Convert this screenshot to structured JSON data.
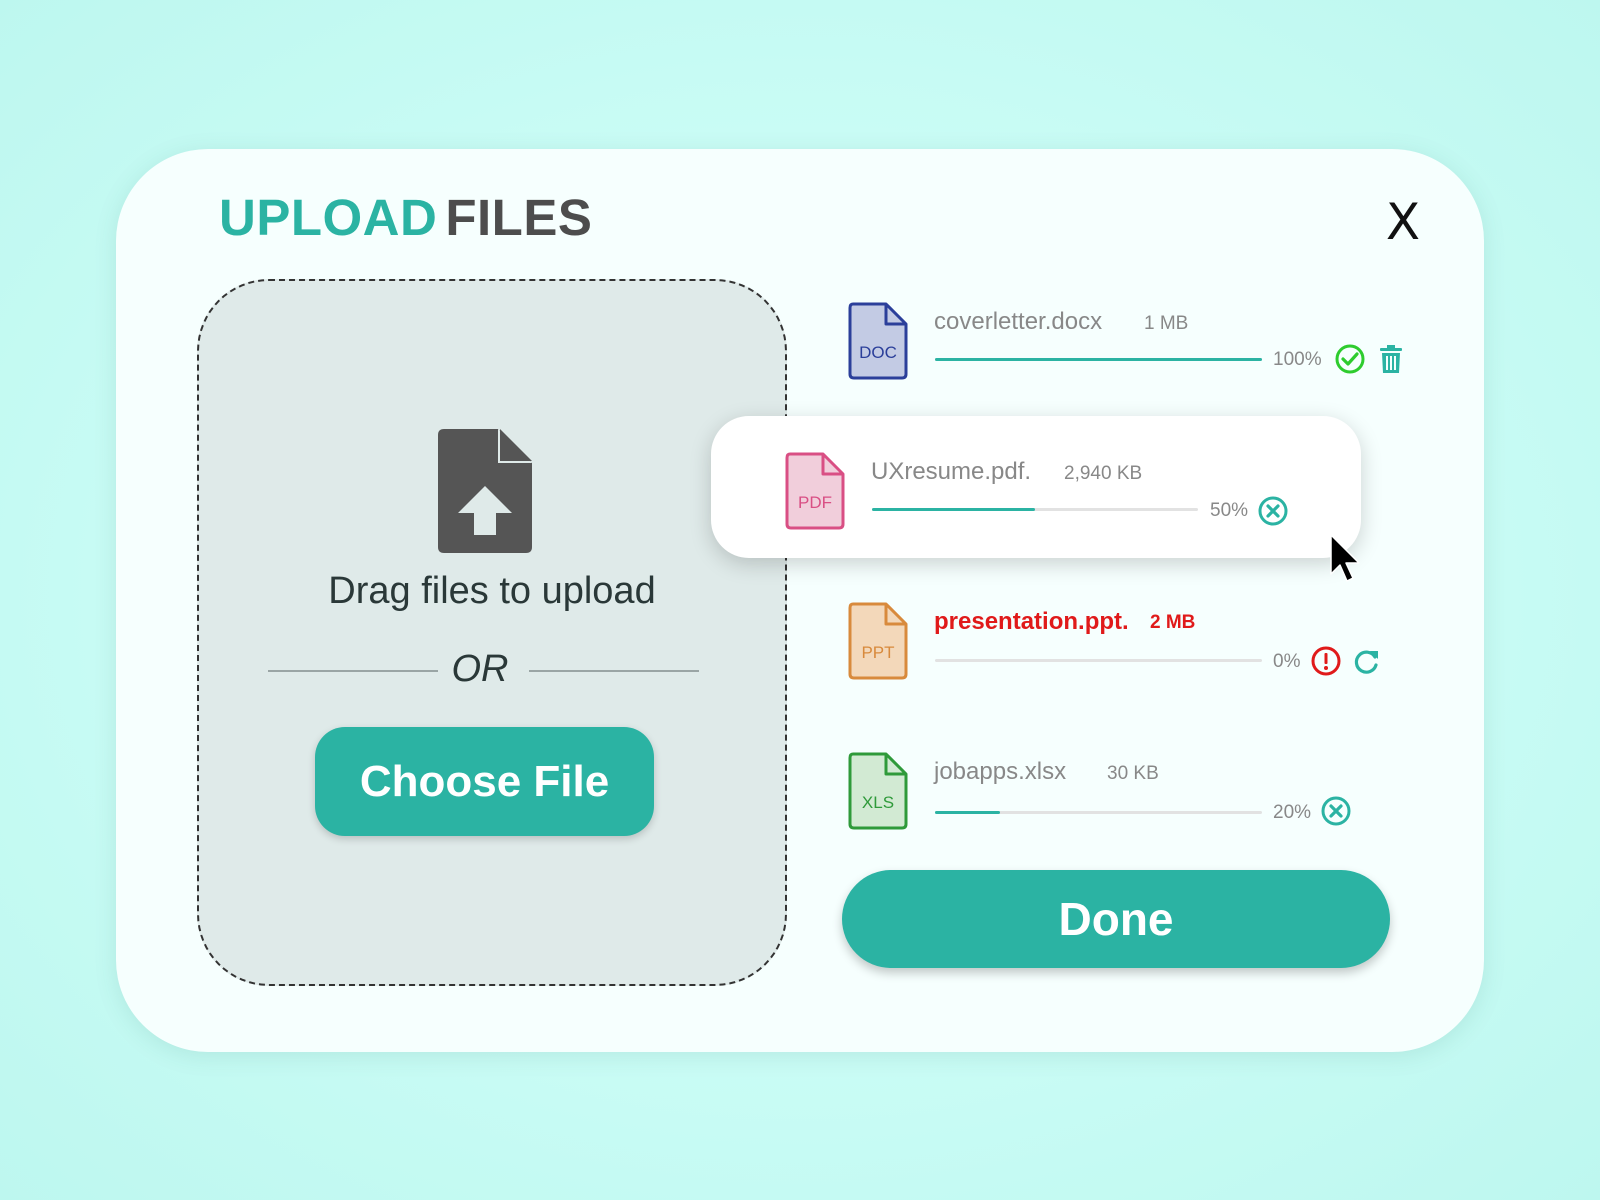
{
  "dialog": {
    "title_accent": "UPLOAD",
    "title_rest": "FILES",
    "close_label": "X"
  },
  "dropzone": {
    "drag_text": "Drag files to upload",
    "or_text": "OR",
    "choose_label": "Choose File"
  },
  "files": [
    {
      "name": "coverletter.docx",
      "size": "1 MB",
      "type_label": "DOC",
      "progress_text": "100%",
      "progress": 1.0,
      "status": "complete",
      "color": "#2b3f9a",
      "fill_color": "#c3cbe4",
      "actions": [
        "check-icon",
        "trash-icon"
      ]
    },
    {
      "name": "UXresume.pdf.",
      "size": "2,940 KB",
      "type_label": "PDF",
      "progress_text": "50%",
      "progress": 0.5,
      "status": "uploading",
      "color": "#d94f84",
      "fill_color": "#f1cedb",
      "actions": [
        "cancel-icon"
      ]
    },
    {
      "name": "presentation.ppt.",
      "size": "2 MB",
      "type_label": "PPT",
      "progress_text": "0%",
      "progress": 0.0,
      "status": "error",
      "color": "#d88a3c",
      "fill_color": "#f3d8ba",
      "actions": [
        "error-icon",
        "retry-icon"
      ]
    },
    {
      "name": "jobapps.xlsx",
      "size": "30 KB",
      "type_label": "XLS",
      "progress_text": "20%",
      "progress": 0.2,
      "status": "uploading",
      "color": "#2f9a3a",
      "fill_color": "#d2ead3",
      "actions": [
        "cancel-icon"
      ]
    }
  ],
  "footer": {
    "done_label": "Done"
  },
  "colors": {
    "accent": "#2bb3a3",
    "error": "#e01a1a",
    "success": "#2ecc2e",
    "background": "#c4fbf3"
  }
}
